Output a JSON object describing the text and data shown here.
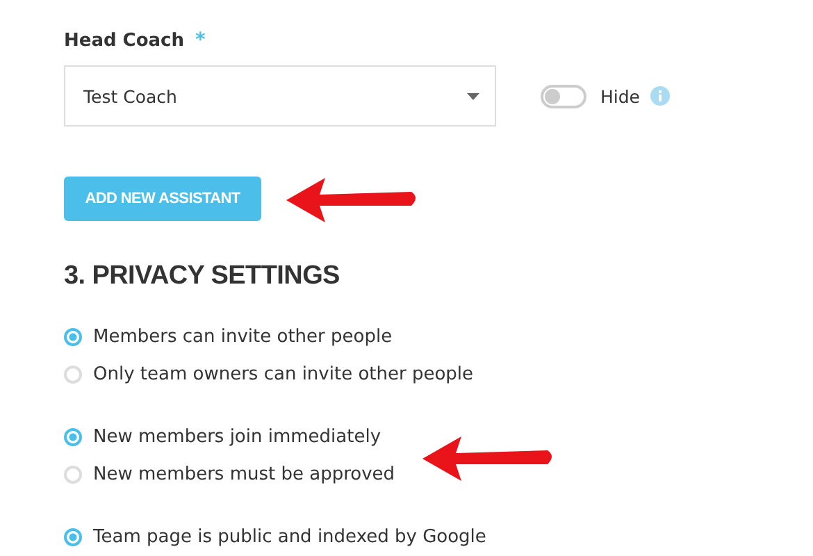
{
  "head_coach": {
    "label": "Head Coach",
    "required_mark": "*",
    "value": "Test Coach"
  },
  "hide_toggle": {
    "label": "Hide",
    "on": false
  },
  "add_button": "ADD NEW ASSISTANT",
  "privacy": {
    "title": "3. PRIVACY SETTINGS",
    "groups": [
      {
        "options": [
          {
            "label": "Members can invite other people",
            "selected": true
          },
          {
            "label": "Only team owners can invite other people",
            "selected": false
          }
        ]
      },
      {
        "options": [
          {
            "label": "New members join immediately",
            "selected": true
          },
          {
            "label": "New members must be approved",
            "selected": false
          }
        ]
      },
      {
        "options": [
          {
            "label": "Team page is public and indexed by Google",
            "selected": true
          }
        ]
      }
    ]
  }
}
